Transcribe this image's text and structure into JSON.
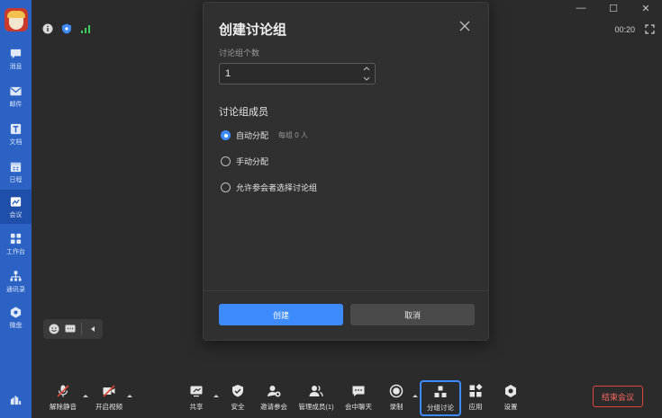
{
  "sidebar": {
    "items": [
      {
        "label": "消息",
        "icon": "chat-icon"
      },
      {
        "label": "邮件",
        "icon": "mail-icon"
      },
      {
        "label": "文档",
        "icon": "doc-icon"
      },
      {
        "label": "日程",
        "icon": "calendar-icon"
      },
      {
        "label": "会议",
        "icon": "meeting-icon"
      },
      {
        "label": "工作台",
        "icon": "grid-icon"
      },
      {
        "label": "通讯录",
        "icon": "contacts-icon"
      },
      {
        "label": "微盘",
        "icon": "drive-icon"
      }
    ]
  },
  "header": {
    "timer": "00:20"
  },
  "modal": {
    "title": "创建讨论组",
    "count_label": "讨论组个数",
    "count_value": "1",
    "members_title": "讨论组成员",
    "options": {
      "auto": "自动分配",
      "auto_hint": "每组 0 人",
      "manual": "手动分配",
      "self_select": "允许参会者选择讨论组"
    },
    "create_label": "创建",
    "cancel_label": "取消"
  },
  "toolbar": {
    "unmute": "解除静音",
    "start_video": "开启视频",
    "share": "共享",
    "security": "安全",
    "invite": "邀请参会",
    "manage": "管理成员(1)",
    "chat": "会中聊天",
    "record": "录制",
    "breakout": "分组讨论",
    "apps": "应用",
    "settings": "设置",
    "end": "结束会议"
  },
  "colors": {
    "sidebar": "#2c62c4",
    "accent": "#3d8bfd",
    "end": "#e0453c",
    "background": "#2b2b2b"
  }
}
